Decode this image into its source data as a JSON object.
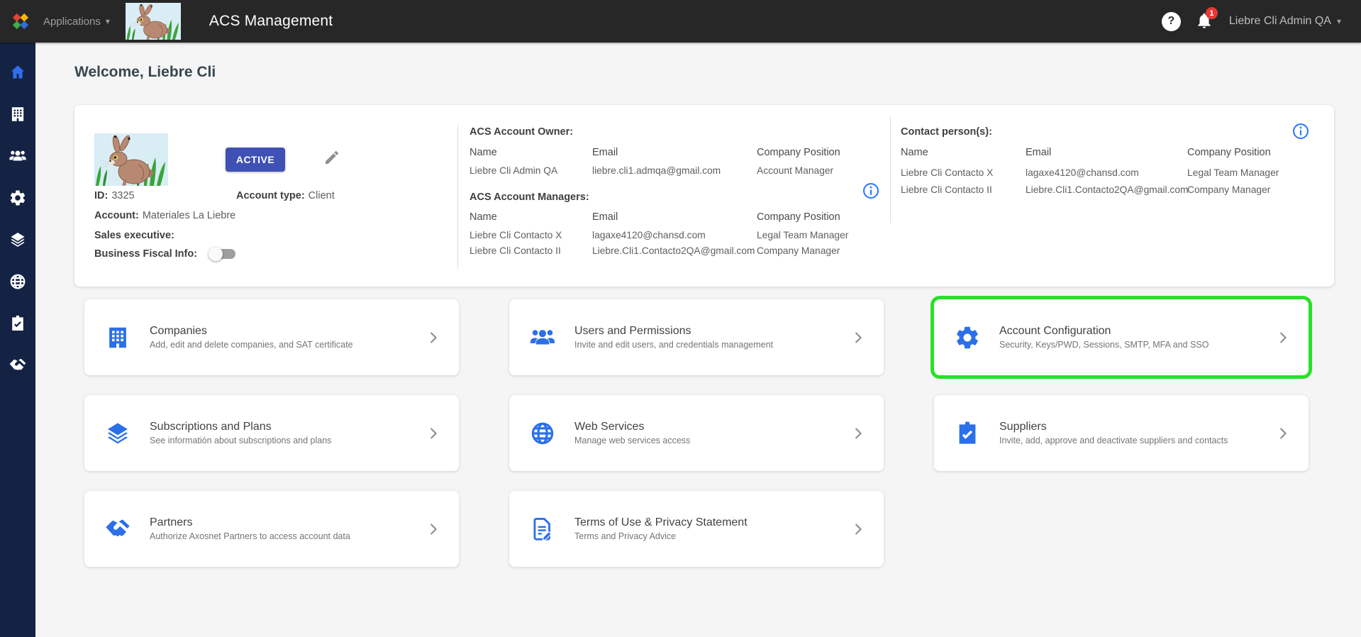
{
  "topbar": {
    "applications_label": "Applications",
    "app_title": "ACS Management",
    "help_label": "?",
    "notification_count": "1",
    "user_name": "Liebre Cli Admin QA"
  },
  "sidebar": {
    "items": [
      {
        "icon": "home-icon",
        "active": true
      },
      {
        "icon": "building-icon",
        "active": false
      },
      {
        "icon": "users-icon",
        "active": false
      },
      {
        "icon": "gear-icon",
        "active": false
      },
      {
        "icon": "layers-icon",
        "active": false
      },
      {
        "icon": "globe-icon",
        "active": false
      },
      {
        "icon": "clipboard-check-icon",
        "active": false
      },
      {
        "icon": "handshake-icon",
        "active": false
      }
    ]
  },
  "main": {
    "welcome_title": "Welcome, Liebre Cli"
  },
  "account_card": {
    "status_badge": "ACTIVE",
    "fields": {
      "id_label": "ID:",
      "id_value": "3325",
      "type_label": "Account type:",
      "type_value": "Client",
      "account_label": "Account:",
      "account_value": "Materiales La Liebre",
      "sales_label": "Sales executive:",
      "sales_value": "",
      "fiscal_label": "Business Fiscal Info:",
      "fiscal_toggle_state": "off"
    },
    "owner": {
      "title": "ACS Account Owner:",
      "headers": [
        "Name",
        "Email",
        "Company Position"
      ],
      "rows": [
        [
          "Liebre Cli Admin QA",
          "liebre.cli1.admqa@gmail.com",
          "Account Manager"
        ]
      ]
    },
    "managers": {
      "title": "ACS Account Managers:",
      "headers": [
        "Name",
        "Email",
        "Company Position"
      ],
      "rows": [
        [
          "Liebre Cli Contacto X",
          "lagaxe4120@chansd.com",
          "Legal Team Manager"
        ],
        [
          "Liebre Cli Contacto II",
          "Liebre.Cli1.Contacto2QA@gmail.com",
          "Company Manager"
        ]
      ]
    },
    "contacts": {
      "title": "Contact person(s):",
      "headers": [
        "Name",
        "Email",
        "Company Position"
      ],
      "rows": [
        [
          "Liebre Cli Contacto X",
          "lagaxe4120@chansd.com",
          "Legal Team Manager"
        ],
        [
          "Liebre Cli Contacto II",
          "Liebre.Cli1.Contacto2QA@gmail.com",
          "Company Manager"
        ]
      ]
    }
  },
  "cards": [
    {
      "title": "Companies",
      "subtitle": "Add, edit and delete companies, and SAT certificate",
      "icon": "building-icon",
      "highlighted": false
    },
    {
      "title": "Users and Permissions",
      "subtitle": "Invite and edit users, and credentials management",
      "icon": "users-icon",
      "highlighted": false
    },
    {
      "title": "Account Configuration",
      "subtitle": "Security, Keys/PWD, Sessions, SMTP, MFA and SSO",
      "icon": "gear-icon",
      "highlighted": true
    },
    {
      "title": "Subscriptions and Plans",
      "subtitle": "See informatión about subscriptions and plans",
      "icon": "layers-icon",
      "highlighted": false
    },
    {
      "title": "Web Services",
      "subtitle": "Manage web services access",
      "icon": "globe-icon",
      "highlighted": false
    },
    {
      "title": "Suppliers",
      "subtitle": "Invite, add, approve and deactivate suppliers and contacts",
      "icon": "clipboard-check-icon",
      "highlighted": false
    },
    {
      "title": "Partners",
      "subtitle": "Authorize Axosnet Partners to access account data",
      "icon": "handshake-icon",
      "highlighted": false
    },
    {
      "title": "Terms of Use & Privacy Statement",
      "subtitle": "Terms and Privacy Advice",
      "icon": "document-edit-icon",
      "highlighted": false
    }
  ],
  "colors": {
    "highlight_green": "#29e129",
    "icon_blue": "#2b70e8",
    "badge_indigo": "#3f51b5",
    "notification_red": "#e53935",
    "sidebar_navy": "#142244",
    "topbar_dark": "#272727"
  }
}
